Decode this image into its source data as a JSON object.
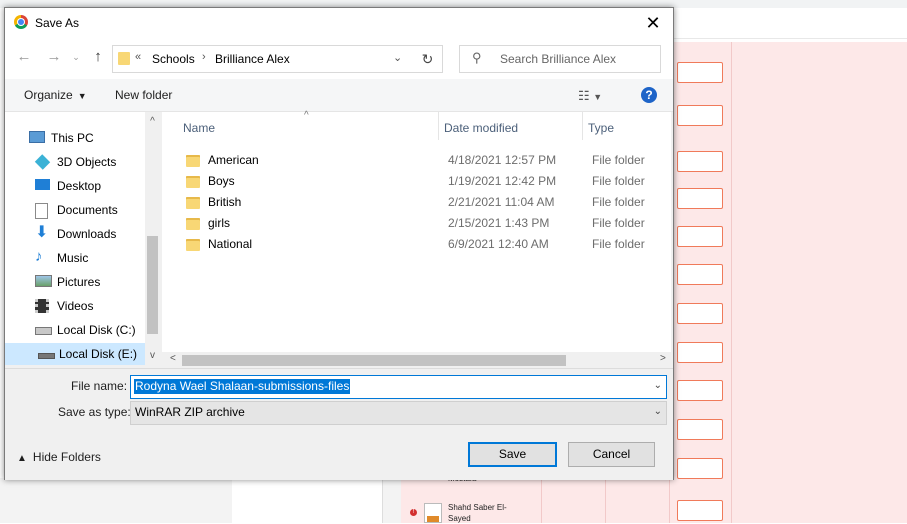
{
  "dialog": {
    "title": "Save As",
    "address": {
      "crumbs": [
        "Schools",
        "Brilliance Alex"
      ],
      "overflow": "«"
    },
    "search_placeholder": "Search Brilliance Alex",
    "toolbar": {
      "organize": "Organize",
      "new_folder": "New folder"
    },
    "nav_items": [
      {
        "label": "This PC",
        "icon": "computer-icon"
      },
      {
        "label": "3D Objects",
        "icon": "cube-icon"
      },
      {
        "label": "Desktop",
        "icon": "desktop-icon"
      },
      {
        "label": "Documents",
        "icon": "document-icon"
      },
      {
        "label": "Downloads",
        "icon": "download-arrow-icon"
      },
      {
        "label": "Music",
        "icon": "music-note-icon"
      },
      {
        "label": "Pictures",
        "icon": "picture-icon"
      },
      {
        "label": "Videos",
        "icon": "film-icon"
      },
      {
        "label": "Local Disk (C:)",
        "icon": "drive-icon"
      },
      {
        "label": "Local Disk (E:)",
        "icon": "drive-icon",
        "selected": true
      }
    ],
    "columns": {
      "name": "Name",
      "date": "Date modified",
      "type": "Type"
    },
    "files": [
      {
        "name": "American",
        "date": "4/18/2021 12:57 PM",
        "type": "File folder"
      },
      {
        "name": "Boys",
        "date": "1/19/2021 12:42 PM",
        "type": "File folder"
      },
      {
        "name": "British",
        "date": "2/21/2021 11:04 AM",
        "type": "File folder"
      },
      {
        "name": "girls",
        "date": "2/15/2021 1:43 PM",
        "type": "File folder"
      },
      {
        "name": "National",
        "date": "6/9/2021 12:40 AM",
        "type": "File folder"
      }
    ],
    "file_name_label": "File name:",
    "file_name_value": "Rodyna Wael Shalaan-submissions-files",
    "save_type_label": "Save as type:",
    "save_type_value": "WinRAR ZIP archive",
    "hide_folders": "Hide Folders",
    "save": "Save",
    "cancel": "Cancel"
  },
  "background": {
    "student_name_partial": "Mostafa",
    "student_name": "Shahd Saber El-Sayed",
    "colors": {
      "pink": "#fde8e8",
      "cell_border": "#f07a5a"
    }
  }
}
